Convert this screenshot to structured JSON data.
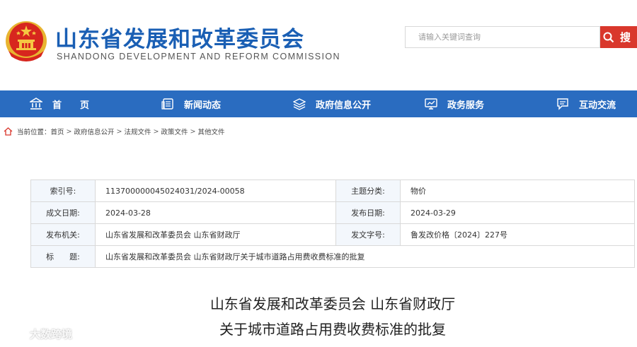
{
  "header": {
    "title": "山东省发展和改革委员会",
    "subtitle": "SHANDONG DEVELOPMENT AND REFORM COMMISSION",
    "search_placeholder": "请输入关键词查询",
    "search_button": "搜"
  },
  "nav": {
    "items": [
      {
        "label": "首　　页",
        "icon": "building-icon"
      },
      {
        "label": "新闻动态",
        "icon": "news-icon"
      },
      {
        "label": "政府信息公开",
        "icon": "layers-icon"
      },
      {
        "label": "政务服务",
        "icon": "monitor-icon"
      },
      {
        "label": "互动交流",
        "icon": "chat-icon"
      }
    ]
  },
  "breadcrumb": {
    "prefix": "当前位置：",
    "items": [
      "首页",
      "政府信息公开",
      "法规文件",
      "政策文件",
      "其他文件"
    ],
    "separator": ">"
  },
  "info": {
    "rows": [
      {
        "label1": "索引号:",
        "value1": "11370000004502403​1/2024-00058",
        "label2": "主题分类:",
        "value2": "物价"
      },
      {
        "label1": "成文日期:",
        "value1": "2024-03-28",
        "label2": "发布日期:",
        "value2": "2024-03-29"
      },
      {
        "label1": "发布机关:",
        "value1": "山东省发展和改革委员会 山东省财政厅",
        "label2": "发文字号:",
        "value2": "鲁发改价格〔2024〕227号"
      }
    ],
    "title_label": "标　　题:",
    "title_value": "山东省发展和改革委员会 山东省财政厅关于城市道路占用费收费标准的批复"
  },
  "document": {
    "title_line1": "山东省发展和改革委员会  山东省财政厅",
    "title_line2": "关于城市道路占用费收费标准的批复"
  },
  "watermark": {
    "text": "大数跨境"
  },
  "colors": {
    "brand_blue": "#1a5fb4",
    "nav_blue": "#2a6cc0",
    "search_red": "#d9372c"
  }
}
